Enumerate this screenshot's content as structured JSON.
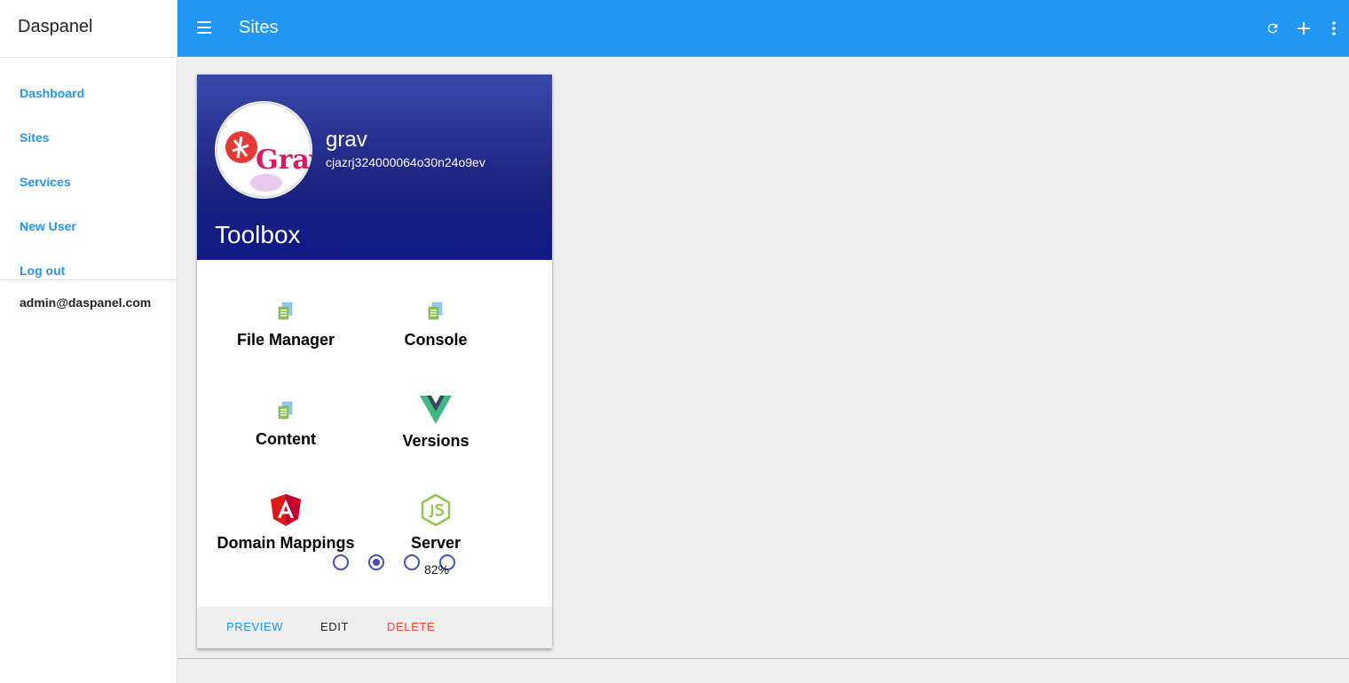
{
  "app": {
    "title": "Daspanel"
  },
  "sidebar": {
    "items": [
      {
        "label": "Dashboard"
      },
      {
        "label": "Sites"
      },
      {
        "label": "Services"
      },
      {
        "label": "New User"
      },
      {
        "label": "Log out"
      }
    ],
    "user_email": "admin@daspanel.com"
  },
  "topbar": {
    "title": "Sites",
    "menu_icon": "hamburger-icon",
    "actions": [
      "refresh-icon",
      "add-icon",
      "more-vert-icon"
    ]
  },
  "card": {
    "site_name": "grav",
    "site_id": "cjazrj324000064o30n24o9ev",
    "avatar_text": "Grav",
    "title": "Toolbox",
    "tools": [
      {
        "label": "File Manager",
        "icon": "file-icon"
      },
      {
        "label": "Console",
        "icon": "file-icon"
      },
      {
        "label": "Content",
        "icon": "file-icon"
      },
      {
        "label": "Versions",
        "icon": "vue-logo-icon"
      },
      {
        "label": "Domain Mappings",
        "icon": "angular-logo-icon"
      },
      {
        "label": "Server",
        "icon": "nodejs-logo-icon"
      }
    ],
    "progress": {
      "value": 82,
      "text": "82%"
    },
    "actions": {
      "preview": "PREVIEW",
      "edit": "EDIT",
      "delete": "DELETE"
    }
  },
  "colors": {
    "primary": "#2196f3",
    "header": "#1a237e",
    "accent": "#3f51b5",
    "delete": "#f44336"
  }
}
